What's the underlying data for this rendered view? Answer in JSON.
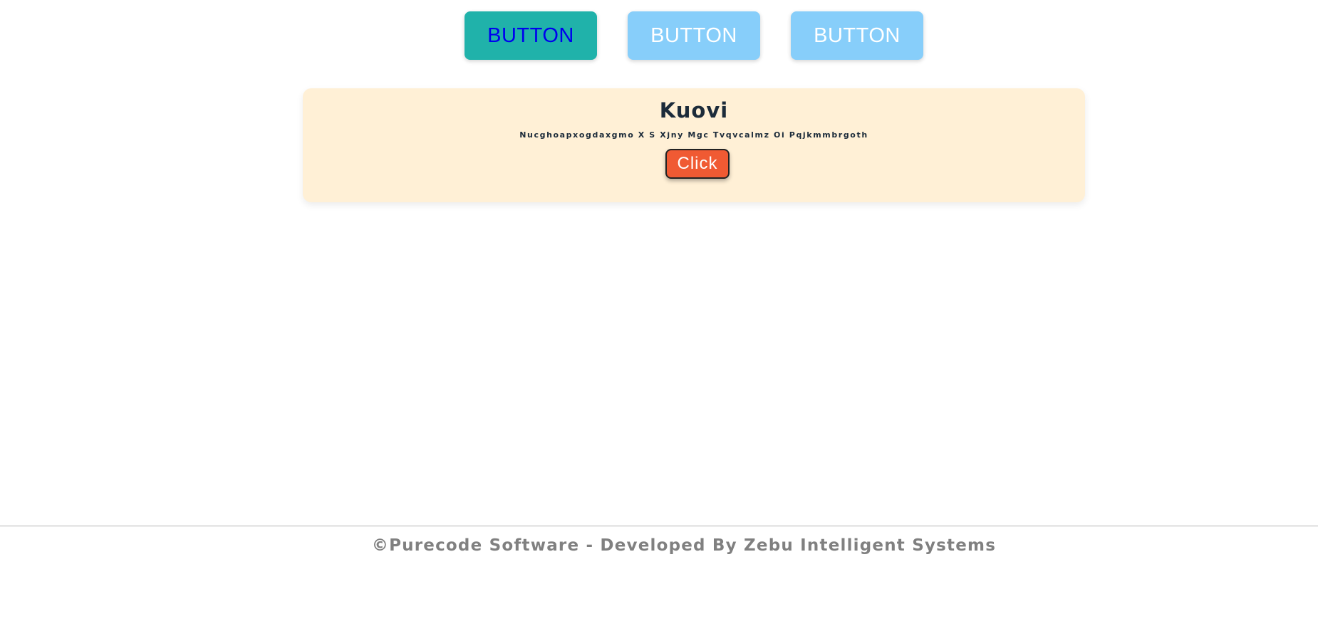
{
  "top_buttons": [
    {
      "label": "BUTTON",
      "bg": "#20b2aa",
      "color": "#0000ee"
    },
    {
      "label": "BUTTON",
      "bg": "#87cefa",
      "color": "#ffffff"
    },
    {
      "label": "BUTTON",
      "bg": "#87cefa",
      "color": "#ffffff"
    }
  ],
  "card": {
    "title": "Kuovi",
    "subtitle": "Nucghoapxogdaxgmo X S Xjny Mgc Tvqvcalmz Oi Pqjkmmbrgoth",
    "button_label": "Click",
    "background": "#fff0d6",
    "button_color": "#f05a33"
  },
  "footer": {
    "text": "©Purecode Software - Developed By Zebu Intelligent Systems",
    "color": "#808080"
  }
}
